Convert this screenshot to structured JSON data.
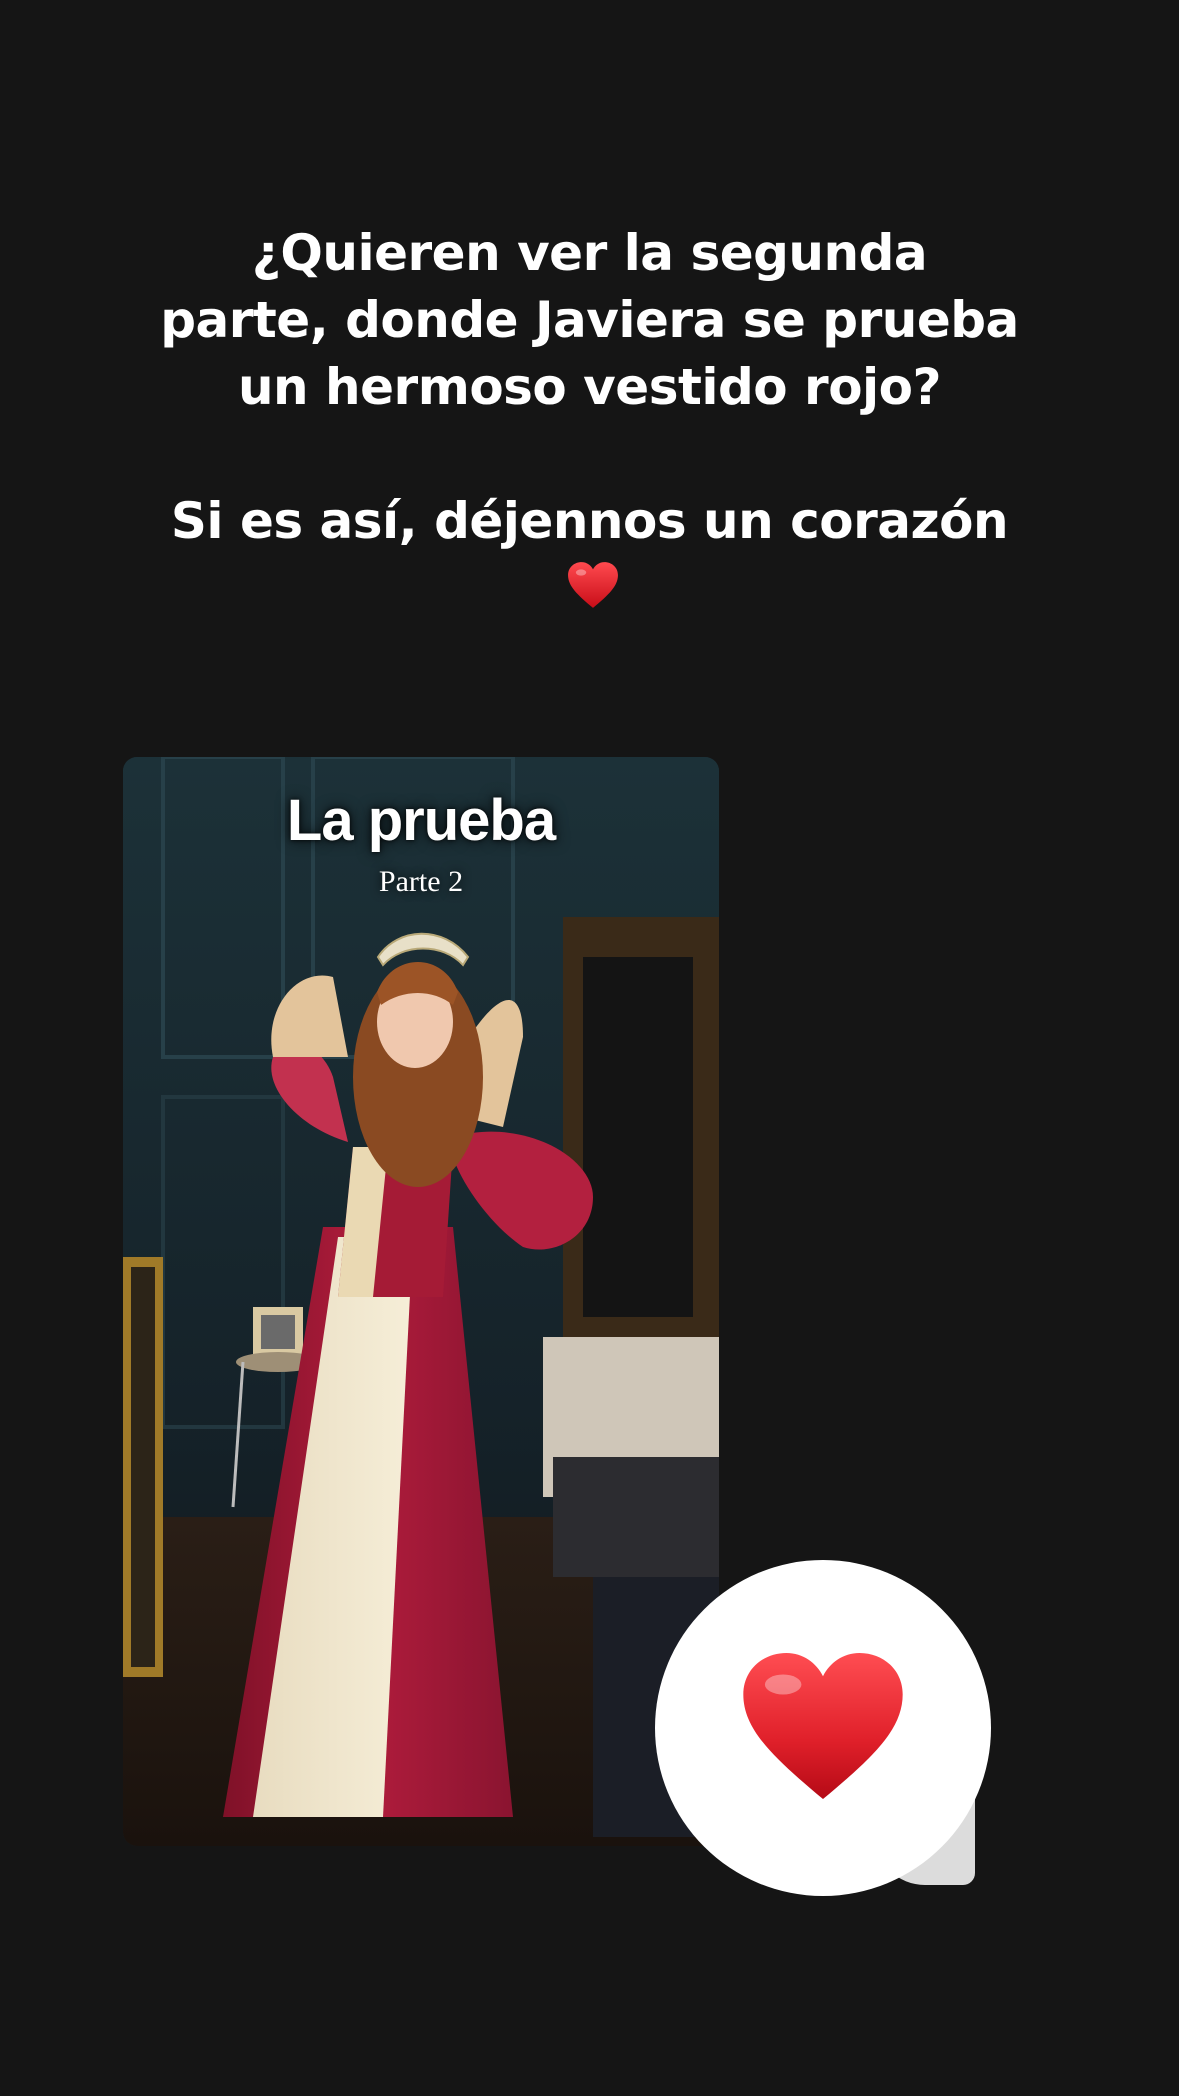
{
  "caption": {
    "question": "¿Quieren ver la segunda parte, donde Javiera se prueba un hermoso vestido rojo?",
    "request": "Si es así, déjennos un corazón"
  },
  "post": {
    "title": "La prueba",
    "subtitle": "Parte 2"
  },
  "reaction": {
    "icon": "red-heart-icon",
    "color": "#e0202a"
  },
  "colors": {
    "background": "#151515",
    "text": "#ffffff",
    "heart": "#e0202a"
  }
}
